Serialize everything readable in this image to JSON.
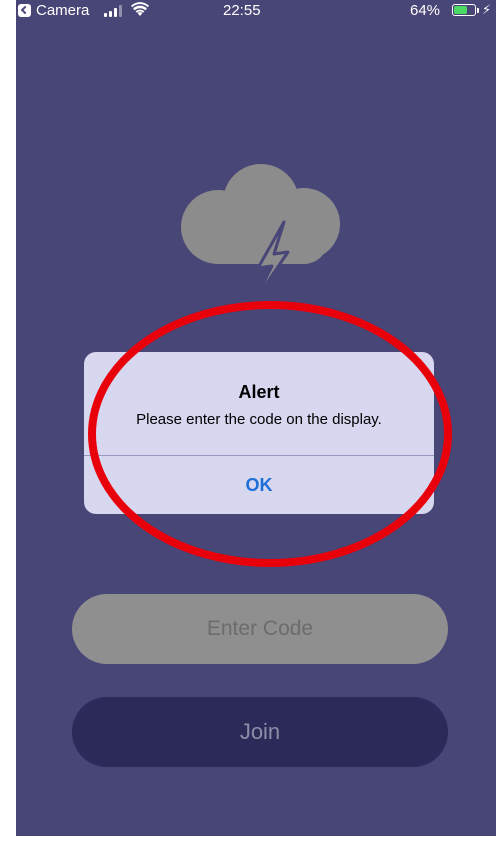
{
  "status_bar": {
    "back_app": "Camera",
    "time": "22:55",
    "battery_percent": "64%",
    "battery_level": 0.64,
    "charging_icon": "bolt-icon"
  },
  "logo": {
    "icon": "cloud-lightning-icon",
    "colors": {
      "cloud": "#8c8c8c",
      "bolt": "#8c8c8c"
    }
  },
  "alert": {
    "title": "Alert",
    "message": "Please enter the code on the display.",
    "ok_label": "OK"
  },
  "form": {
    "code_placeholder": "Enter Code",
    "code_value": "",
    "join_label": "Join"
  },
  "colors": {
    "background": "#484577",
    "alert_background": "#d7d7f0",
    "alert_button": "#1f6fd8",
    "highlight": "#e8000b",
    "join_button": "#2b2a59",
    "code_field": "#8f8f8f"
  }
}
